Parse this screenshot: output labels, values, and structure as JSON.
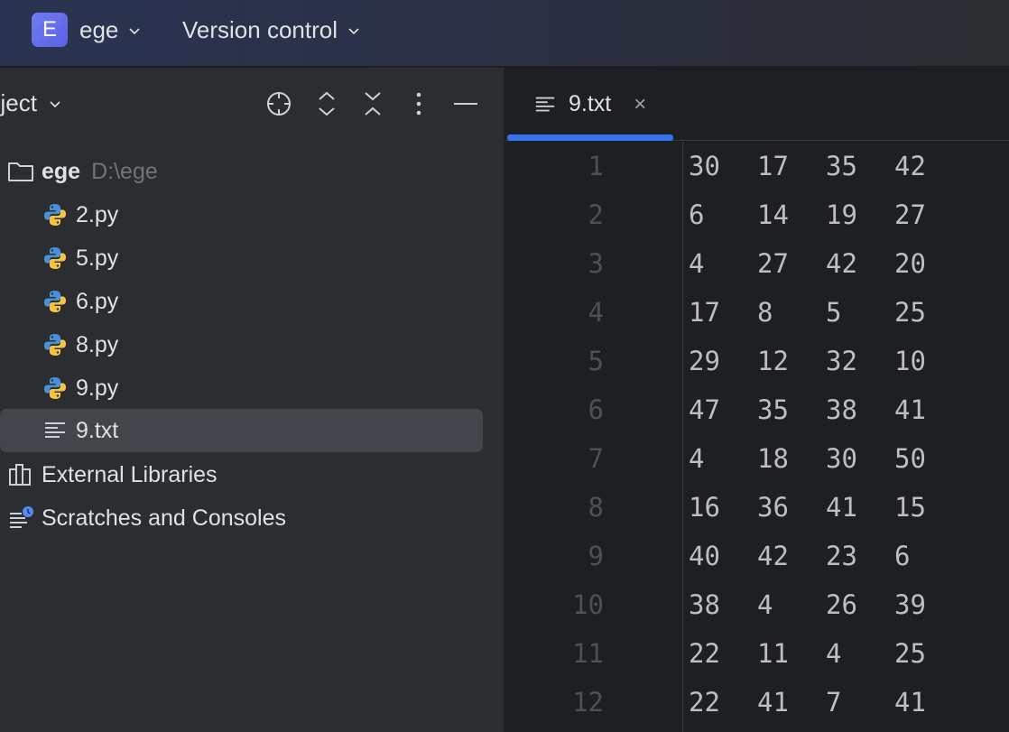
{
  "titlebar": {
    "project_initial": "E",
    "project_name": "ege",
    "vcs_label": "Version control"
  },
  "project_panel": {
    "title": "oject",
    "icons": [
      "locate-icon",
      "expand-all-icon",
      "collapse-all-icon",
      "more-options-icon",
      "hide-panel-icon"
    ]
  },
  "tree": {
    "root": {
      "name": "ege",
      "path": "D:\\ege"
    },
    "files": [
      {
        "name": "2.py",
        "type": "python"
      },
      {
        "name": "5.py",
        "type": "python"
      },
      {
        "name": "6.py",
        "type": "python"
      },
      {
        "name": "8.py",
        "type": "python"
      },
      {
        "name": "9.py",
        "type": "python"
      },
      {
        "name": "9.txt",
        "type": "text",
        "selected": true
      }
    ],
    "external_libraries": "External Libraries",
    "scratches": "Scratches and Consoles"
  },
  "editor": {
    "tab_label": "9.txt",
    "tab_close": "×",
    "lines": [
      [
        "30",
        "17",
        "35",
        "42"
      ],
      [
        "6",
        "14",
        "19",
        "27"
      ],
      [
        "4",
        "27",
        "42",
        "20"
      ],
      [
        "17",
        "8",
        "5",
        "25"
      ],
      [
        "29",
        "12",
        "32",
        "10"
      ],
      [
        "47",
        "35",
        "38",
        "41"
      ],
      [
        "4",
        "18",
        "30",
        "50"
      ],
      [
        "16",
        "36",
        "41",
        "15"
      ],
      [
        "40",
        "42",
        "23",
        "6"
      ],
      [
        "38",
        "4",
        "26",
        "39"
      ],
      [
        "22",
        "11",
        "4",
        "25"
      ],
      [
        "22",
        "41",
        "7",
        "41"
      ]
    ],
    "line_numbers": [
      "1",
      "2",
      "3",
      "4",
      "5",
      "6",
      "7",
      "8",
      "9",
      "10",
      "11",
      "12"
    ]
  },
  "colors": {
    "accent": "#3574f0",
    "project_badge": "#6366f1",
    "panel_bg": "#2b2d30",
    "editor_bg": "#1e1f22",
    "selection_bg": "#43454a"
  }
}
